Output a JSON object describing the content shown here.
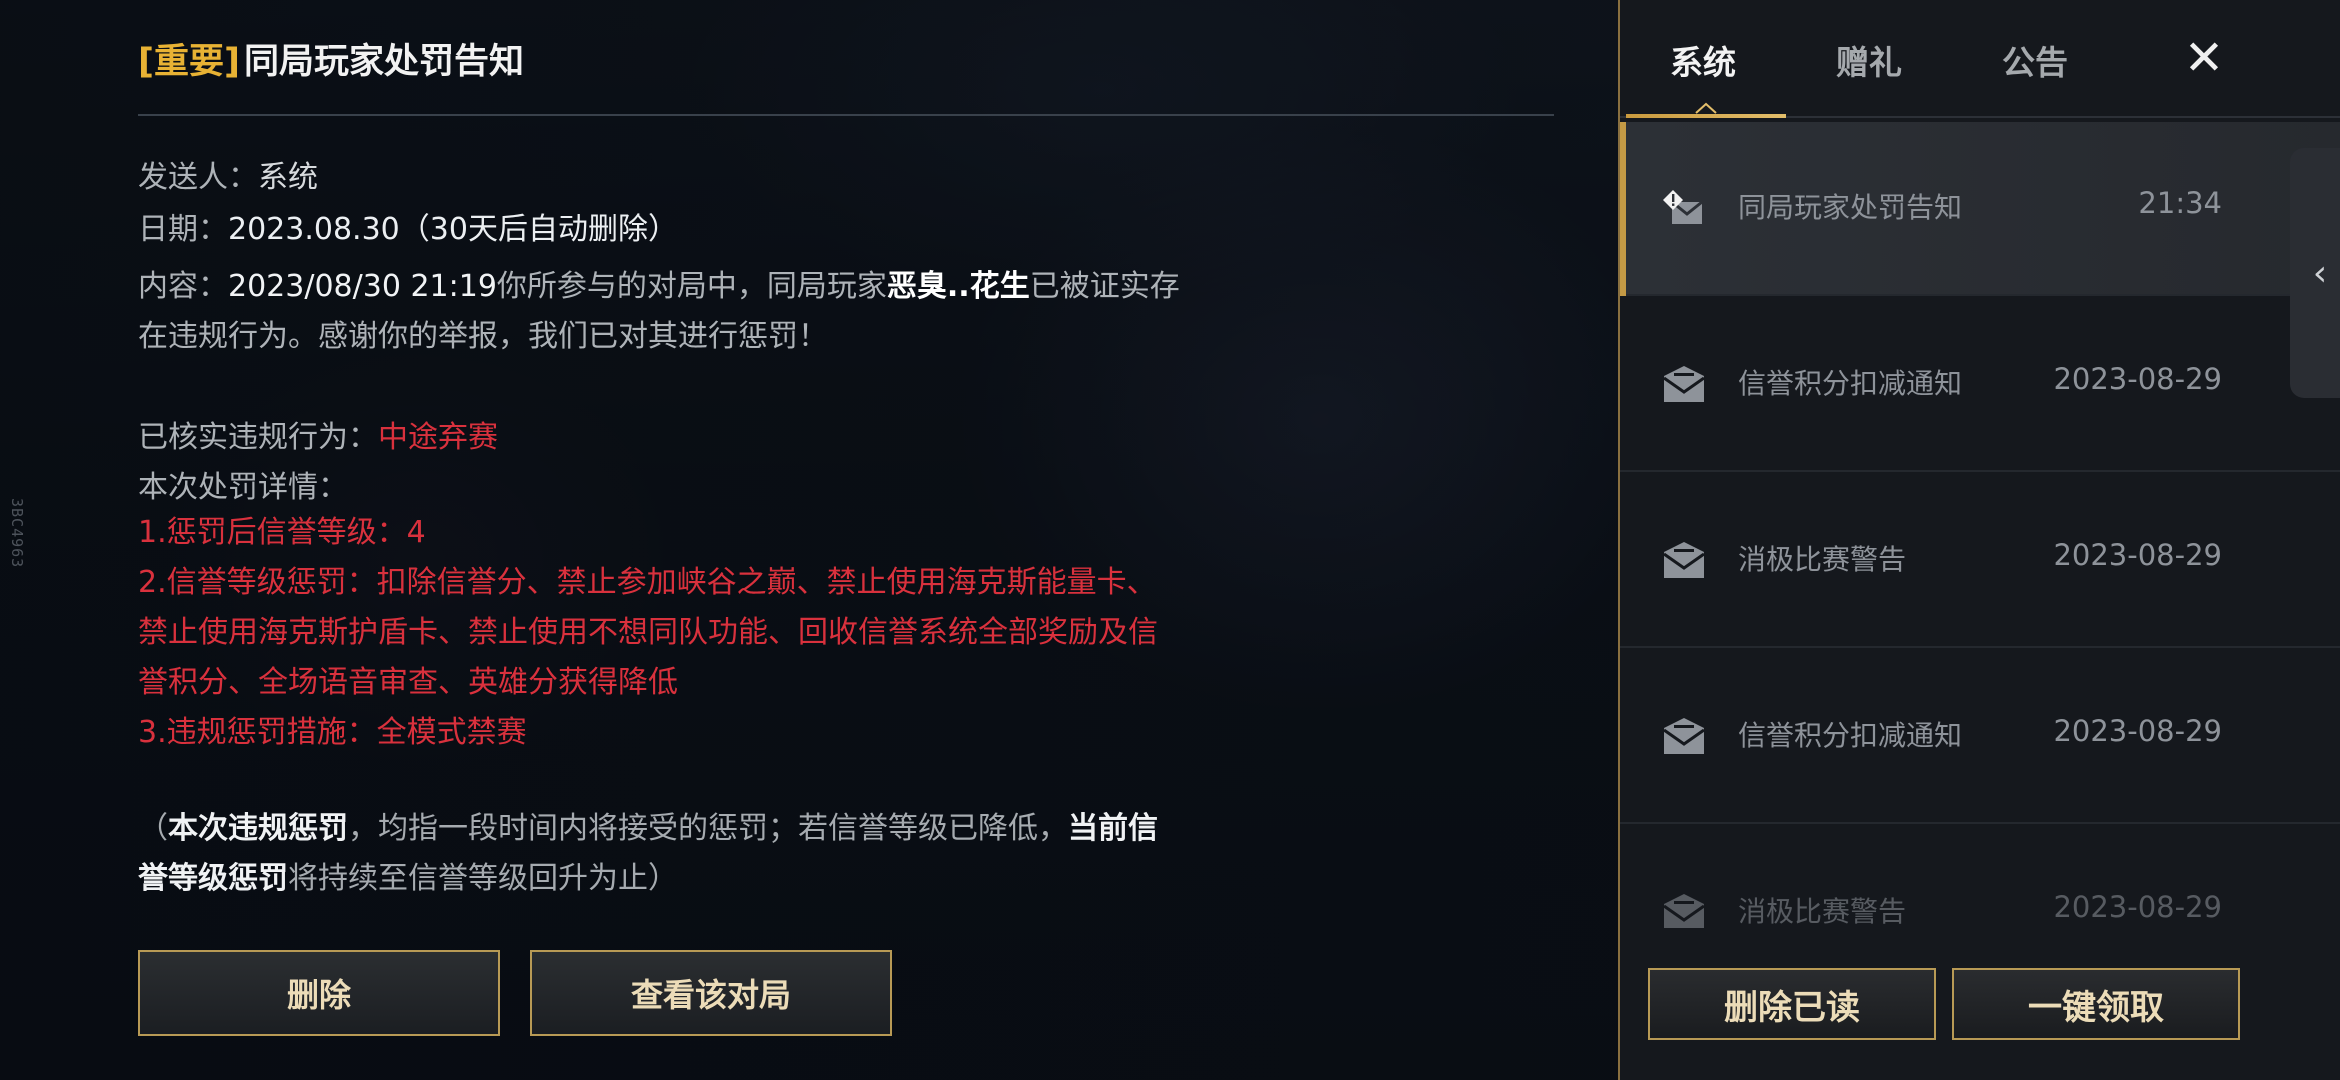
{
  "side_code": "3BC4963",
  "mail": {
    "tag": "[重要]",
    "title": "同局玩家处罚告知",
    "sender_label": "发送人：",
    "sender": "系统",
    "date_label": "日期：",
    "date": "2023.08.30（30天后自动删除）",
    "content_label": "内容：",
    "content_time": "2023/08/30 21:19",
    "content_part1": "你所参与的对局中，同局玩家",
    "player_name": "恶臭..花生",
    "content_part2": "已被证实存",
    "content_line2": "在违规行为。感谢你的举报，我们已对其进行惩罚！",
    "verified_label": "已核实违规行为：",
    "verified_value": "中途弃赛",
    "details_label": "本次处罚详情：",
    "penalty_1": "1.惩罚后信誉等级：4",
    "penalty_2_line1": "2.信誉等级惩罚：扣除信誉分、禁止参加峡谷之巅、禁止使用海克斯能量卡、",
    "penalty_2_line2": "禁止使用海克斯护盾卡、禁止使用不想同队功能、回收信誉系统全部奖励及信",
    "penalty_2_line3": "誉积分、全场语音审查、英雄分获得降低",
    "penalty_3": "3.违规惩罚措施：全模式禁赛",
    "note_open": "（",
    "note_bold1": "本次违规惩罚",
    "note_text1": "，均指一段时间内将接受的惩罚；若信誉等级已降低，",
    "note_bold2a": "当前信",
    "note_bold2b": "誉等级惩罚",
    "note_text2": "将持续至信誉等级回升为止）",
    "delete_btn": "删除",
    "view_match_btn": "查看该对局"
  },
  "panel": {
    "tabs": [
      "系统",
      "赠礼",
      "公告"
    ],
    "close_glyph": "✕",
    "collapse_glyph": "‹",
    "items": [
      {
        "subject": "同局玩家处罚告知",
        "date": "21:34",
        "icon": "important-mail-icon"
      },
      {
        "subject": "信誉积分扣减通知",
        "date": "2023-08-29",
        "icon": "mail-read-icon"
      },
      {
        "subject": "消极比赛警告",
        "date": "2023-08-29",
        "icon": "mail-read-icon"
      },
      {
        "subject": "信誉积分扣减通知",
        "date": "2023-08-29",
        "icon": "mail-read-icon"
      },
      {
        "subject": "消极比赛警告",
        "date": "2023-08-29",
        "icon": "mail-read-icon"
      }
    ],
    "delete_read_btn": "删除已读",
    "claim_all_btn": "一键领取"
  },
  "colors": {
    "accent_gold": "#e8b234",
    "penalty_red": "#d9313d",
    "border_gold": "#b89a55"
  }
}
